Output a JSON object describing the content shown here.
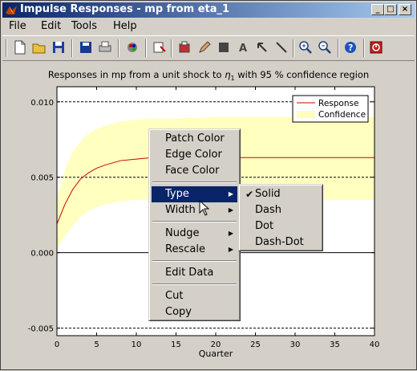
{
  "window": {
    "title": "Impulse Responses - mp from eta_1"
  },
  "menubar": [
    "File",
    "Edit",
    "Tools",
    "Help"
  ],
  "toolbar_icons": [
    "new-file-icon",
    "open-folder-icon",
    "save-icon",
    "save-disk-icon",
    "print-icon",
    "colorbar-icon",
    "copy-figure-icon",
    "data-cursor-icon",
    "pen-icon",
    "rectangle-icon",
    "text-icon",
    "arrow-icon",
    "line-icon",
    "zoom-in-icon",
    "zoom-out-icon",
    "help-icon",
    "exit-icon"
  ],
  "plot": {
    "title_pre": "Responses in mp from a unit shock to ",
    "title_sym": "η",
    "title_sub": "1",
    "title_post": " with 95 % confidence region",
    "xlabel": "Quarter",
    "legend": {
      "response": "Response",
      "confidence": "Confidence"
    }
  },
  "chart_data": {
    "type": "area",
    "xlabel": "Quarter",
    "xlim": [
      0,
      40
    ],
    "ylim": [
      -0.0055,
      0.011
    ],
    "xticks": [
      "0",
      "5",
      "10",
      "15",
      "20",
      "25",
      "30",
      "35",
      "40"
    ],
    "yticks": [
      "-0.005",
      "0.000",
      "0.005",
      "0.010"
    ],
    "ytick_values": [
      -0.005,
      0.0,
      0.005,
      0.01
    ],
    "dashed_lines": [
      -0.005,
      0.005,
      0.01
    ],
    "series": [
      {
        "name": "Response",
        "x": [
          0,
          1,
          2,
          3,
          4,
          5,
          6,
          8,
          10,
          12,
          15,
          20,
          25,
          30,
          35,
          40
        ],
        "values": [
          0.0019,
          0.0032,
          0.0042,
          0.0049,
          0.0053,
          0.0056,
          0.0058,
          0.0061,
          0.0062,
          0.0063,
          0.0063,
          0.0063,
          0.0063,
          0.0063,
          0.0063,
          0.0063
        ]
      },
      {
        "name": "Confidence",
        "x": [
          0,
          1,
          2,
          3,
          4,
          5,
          6,
          8,
          10,
          12,
          15,
          20,
          25,
          30,
          35,
          40
        ],
        "lower": [
          0.0003,
          0.0011,
          0.0018,
          0.0024,
          0.0028,
          0.003,
          0.0032,
          0.0034,
          0.0035,
          0.0035,
          0.0035,
          0.0035,
          0.0035,
          0.0035,
          0.0035,
          0.0035
        ],
        "upper": [
          0.0035,
          0.0055,
          0.0067,
          0.0074,
          0.0079,
          0.0082,
          0.0084,
          0.0087,
          0.0088,
          0.0089,
          0.0089,
          0.009,
          0.009,
          0.009,
          0.009,
          0.009
        ]
      }
    ],
    "colors": {
      "response": "#cc0000",
      "confidence": "#ffffc0"
    },
    "legend_position": "top-right",
    "grid": false
  },
  "context_menu": {
    "items": [
      "Patch Color",
      "Edge Color",
      "Face Color",
      "Type",
      "Width",
      "Nudge",
      "Rescale",
      "Edit Data",
      "Cut",
      "Copy"
    ],
    "highlighted": "Type"
  },
  "submenu": {
    "items": [
      "Solid",
      "Dash",
      "Dot",
      "Dash-Dot"
    ],
    "checked": "Solid"
  }
}
